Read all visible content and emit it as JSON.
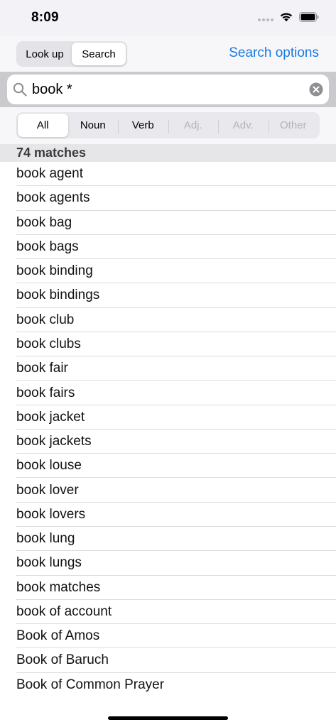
{
  "status_bar": {
    "time": "8:09",
    "icons": [
      "signal-dots-icon",
      "wifi-icon",
      "battery-icon"
    ]
  },
  "nav": {
    "mode_toggle": [
      {
        "label": "Look up",
        "active": false
      },
      {
        "label": "Search",
        "active": true
      }
    ],
    "search_options_label": "Search options",
    "accent_color": "#1a7ae0"
  },
  "search": {
    "value": "book *",
    "icons": [
      "search-icon",
      "clear-icon"
    ]
  },
  "filters": [
    {
      "label": "All",
      "active": true,
      "enabled": true
    },
    {
      "label": "Noun",
      "active": false,
      "enabled": true
    },
    {
      "label": "Verb",
      "active": false,
      "enabled": true
    },
    {
      "label": "Adj.",
      "active": false,
      "enabled": false
    },
    {
      "label": "Adv.",
      "active": false,
      "enabled": false
    },
    {
      "label": "Other",
      "active": false,
      "enabled": false
    }
  ],
  "results": {
    "header": "74 matches",
    "items": [
      "book agent",
      "book agents",
      "book bag",
      "book bags",
      "book binding",
      "book bindings",
      "book club",
      "book clubs",
      "book fair",
      "book fairs",
      "book jacket",
      "book jackets",
      "book louse",
      "book lover",
      "book lovers",
      "book lung",
      "book lungs",
      "book matches",
      "book of account",
      "Book of Amos",
      "Book of Baruch",
      "Book of Common Prayer"
    ]
  }
}
